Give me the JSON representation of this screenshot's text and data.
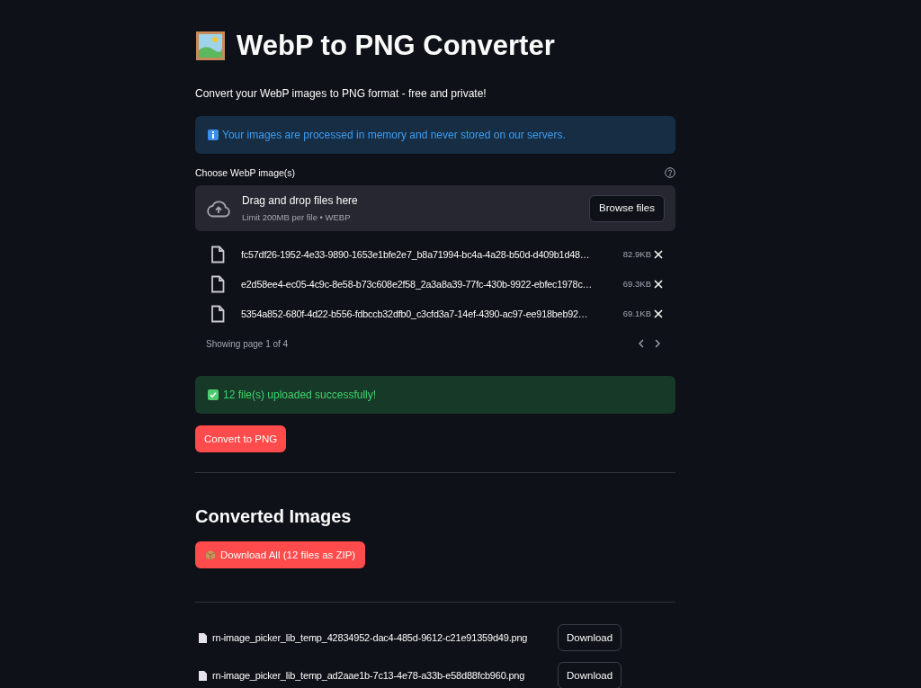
{
  "title": "WebP to PNG Converter",
  "subtitle": "Convert your WebP images to PNG format - free and private!",
  "info_alert": "Your images are processed in memory and never stored on our servers.",
  "uploader": {
    "label": "Choose WebP image(s)",
    "drop_text": "Drag and drop files here",
    "limit": "Limit 200MB per file • WEBP",
    "browse_button": "Browse files",
    "files": [
      {
        "name": "fc57df26-1952-4e33-9890-1653e1bfe2e7_b8a71994-bc4a-4a28-b50d-d409b1d48…",
        "size": "82.9KB"
      },
      {
        "name": "e2d58ee4-ec05-4c9c-8e58-b73c608e2f58_2a3a8a39-77fc-430b-9922-ebfec1978c…",
        "size": "69.3KB"
      },
      {
        "name": "5354a852-680f-4d22-b556-fdbccb32dfb0_c3cfd3a7-14ef-4390-ac97-ee918beb92…",
        "size": "69.1KB"
      }
    ],
    "pagination": "Showing page 1 of 4"
  },
  "success_alert": "12 file(s) uploaded successfully!",
  "convert_button": "Convert to PNG",
  "converted_heading": "Converted Images",
  "download_all_button": "Download All (12 files as ZIP)",
  "downloads": [
    {
      "name": "rn-image_picker_lib_temp_42834952-dac4-485d-9612-c21e91359d49.png",
      "button": "Download"
    },
    {
      "name": "rn-image_picker_lib_temp_ad2aae1b-7c13-4e78-a33b-e58d88fcb960.png",
      "button": "Download"
    }
  ]
}
